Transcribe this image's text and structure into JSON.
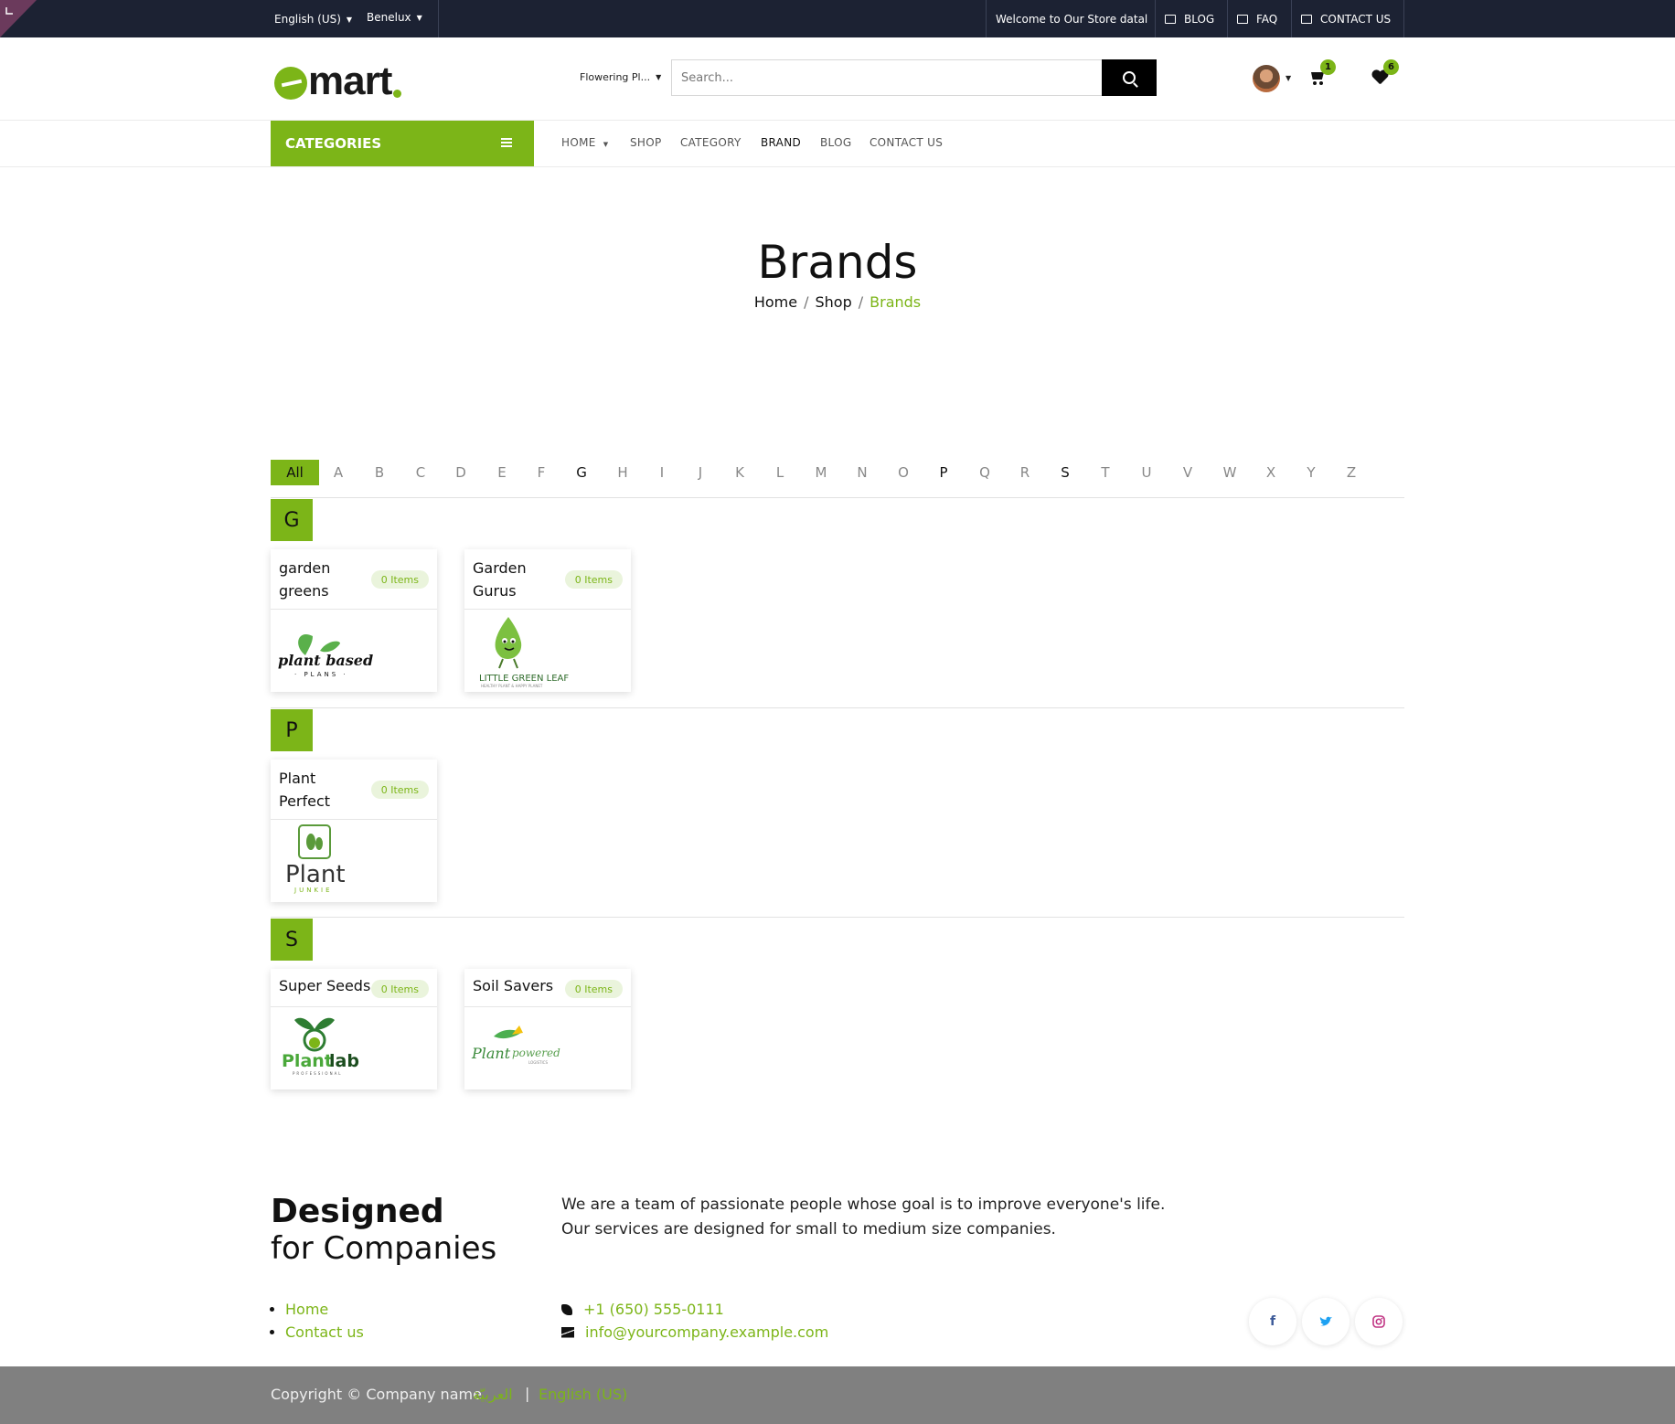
{
  "topbar": {
    "language": "English (US)",
    "region": "Benelux",
    "welcome": "Welcome to Our Store datal",
    "blog": "BLOG",
    "faq": "FAQ",
    "contact": "CONTACT US"
  },
  "header": {
    "logo_text": "mart",
    "category_select": "Flowering Pl...",
    "search_placeholder": "Search...",
    "cart_count": "1",
    "wishlist_count": "6"
  },
  "nav": {
    "categories_label": "CATEGORIES",
    "items": [
      "HOME",
      "SHOP",
      "CATEGORY",
      "BRAND",
      "BLOG",
      "CONTACT US"
    ],
    "active": "BRAND"
  },
  "page": {
    "title": "Brands",
    "breadcrumb": [
      "Home",
      "Shop",
      "Brands"
    ]
  },
  "alphabet": {
    "all_label": "All",
    "letters": [
      "A",
      "B",
      "C",
      "D",
      "E",
      "F",
      "G",
      "H",
      "I",
      "J",
      "K",
      "L",
      "M",
      "N",
      "O",
      "P",
      "Q",
      "R",
      "S",
      "T",
      "U",
      "V",
      "W",
      "X",
      "Y",
      "Z"
    ],
    "letters_with_brands": [
      "G",
      "P",
      "S"
    ]
  },
  "groups": [
    {
      "letter": "G",
      "brands": [
        {
          "name": "garden greens",
          "count": "0 Items",
          "logo": "plant based PLANS"
        },
        {
          "name": "Garden Gurus",
          "count": "0 Items",
          "logo": "LITTLE GREEN LEAF"
        }
      ]
    },
    {
      "letter": "P",
      "brands": [
        {
          "name": "Plant Perfect",
          "count": "0 Items",
          "logo": "Plant JUNKIE"
        }
      ]
    },
    {
      "letter": "S",
      "brands": [
        {
          "name": "Super Seeds",
          "count": "0 Items",
          "logo": "Plantlab"
        },
        {
          "name": "Soil Savers",
          "count": "0 Items",
          "logo": "Plant powered"
        }
      ]
    }
  ],
  "footer": {
    "title": "Designed",
    "subtitle": "for Companies",
    "text_line1": "We are a team of passionate people whose goal is to improve everyone's life.",
    "text_line2": "Our services are designed for small to medium size companies.",
    "links": [
      "Home",
      "Contact us"
    ],
    "phone": "+1 (650) 555-0111",
    "email": "info@yourcompany.example.com",
    "copyright": "Copyright © Company name",
    "lang_ar": "العربيّة",
    "lang_en": "English (US)"
  },
  "colors": {
    "accent": "#7cb518",
    "topbar": "#1c2233",
    "footer_bar": "#808080"
  }
}
